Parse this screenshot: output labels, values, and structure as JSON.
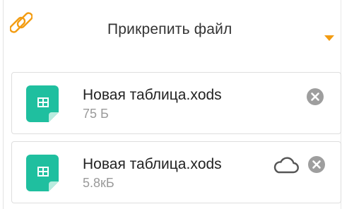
{
  "attach": {
    "label": "Прикрепить файл",
    "icon": "paperclip-icon",
    "caret_icon": "caret-down-icon",
    "accent_color": "#f39c12"
  },
  "files": [
    {
      "name": "Новая таблица.xods",
      "size": "75 Б",
      "icon": "spreadsheet-file-icon",
      "remove_icon": "remove-icon"
    },
    {
      "name": "Новая таблица.xods",
      "size": "5.8кБ",
      "icon": "spreadsheet-file-icon",
      "cloud_icon": "cloud-icon",
      "remove_icon": "remove-icon"
    }
  ],
  "colors": {
    "file_icon": "#1fbf9f",
    "remove_icon": "#9e9e9e",
    "cloud_icon": "#555555"
  }
}
